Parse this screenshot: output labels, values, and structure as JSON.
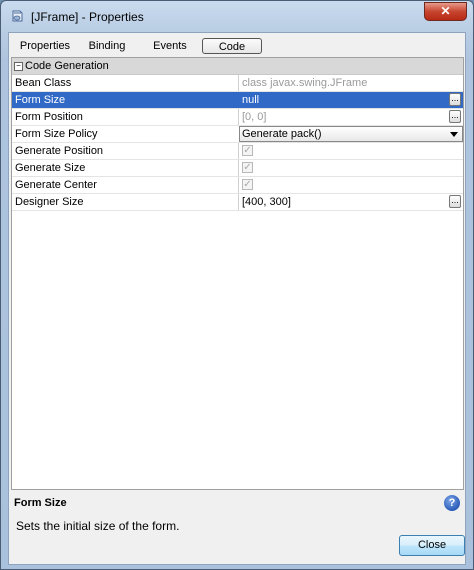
{
  "window": {
    "title": "[JFrame] - Properties",
    "close_glyph": "✕",
    "icon": "java-component-icon"
  },
  "tabs": [
    {
      "label": "Properties",
      "active": false
    },
    {
      "label": "Binding",
      "active": false
    },
    {
      "label": "Events",
      "active": false
    },
    {
      "label": "Code",
      "active": true
    }
  ],
  "category": {
    "toggle_glyph": "−",
    "label": "Code Generation"
  },
  "properties": [
    {
      "name": "Bean Class",
      "value": "class javax.swing.JFrame"
    },
    {
      "name": "Form Size",
      "value": "null",
      "ellipsis": "..."
    },
    {
      "name": "Form Position",
      "value": "[0, 0]",
      "ellipsis": "..."
    },
    {
      "name": "Form Size Policy",
      "value": "Generate pack()"
    },
    {
      "name": "Generate Position",
      "checked": true
    },
    {
      "name": "Generate Size",
      "checked": true
    },
    {
      "name": "Generate Center",
      "checked": true
    },
    {
      "name": "Designer Size",
      "value": "[400, 300]",
      "ellipsis": "..."
    }
  ],
  "description": {
    "title": "Form Size",
    "text": "Sets the initial size of the form.",
    "help_glyph": "?"
  },
  "buttons": {
    "close_label": "Close"
  },
  "colors": {
    "selection": "#3169c6",
    "title_close": "#c7452f"
  }
}
